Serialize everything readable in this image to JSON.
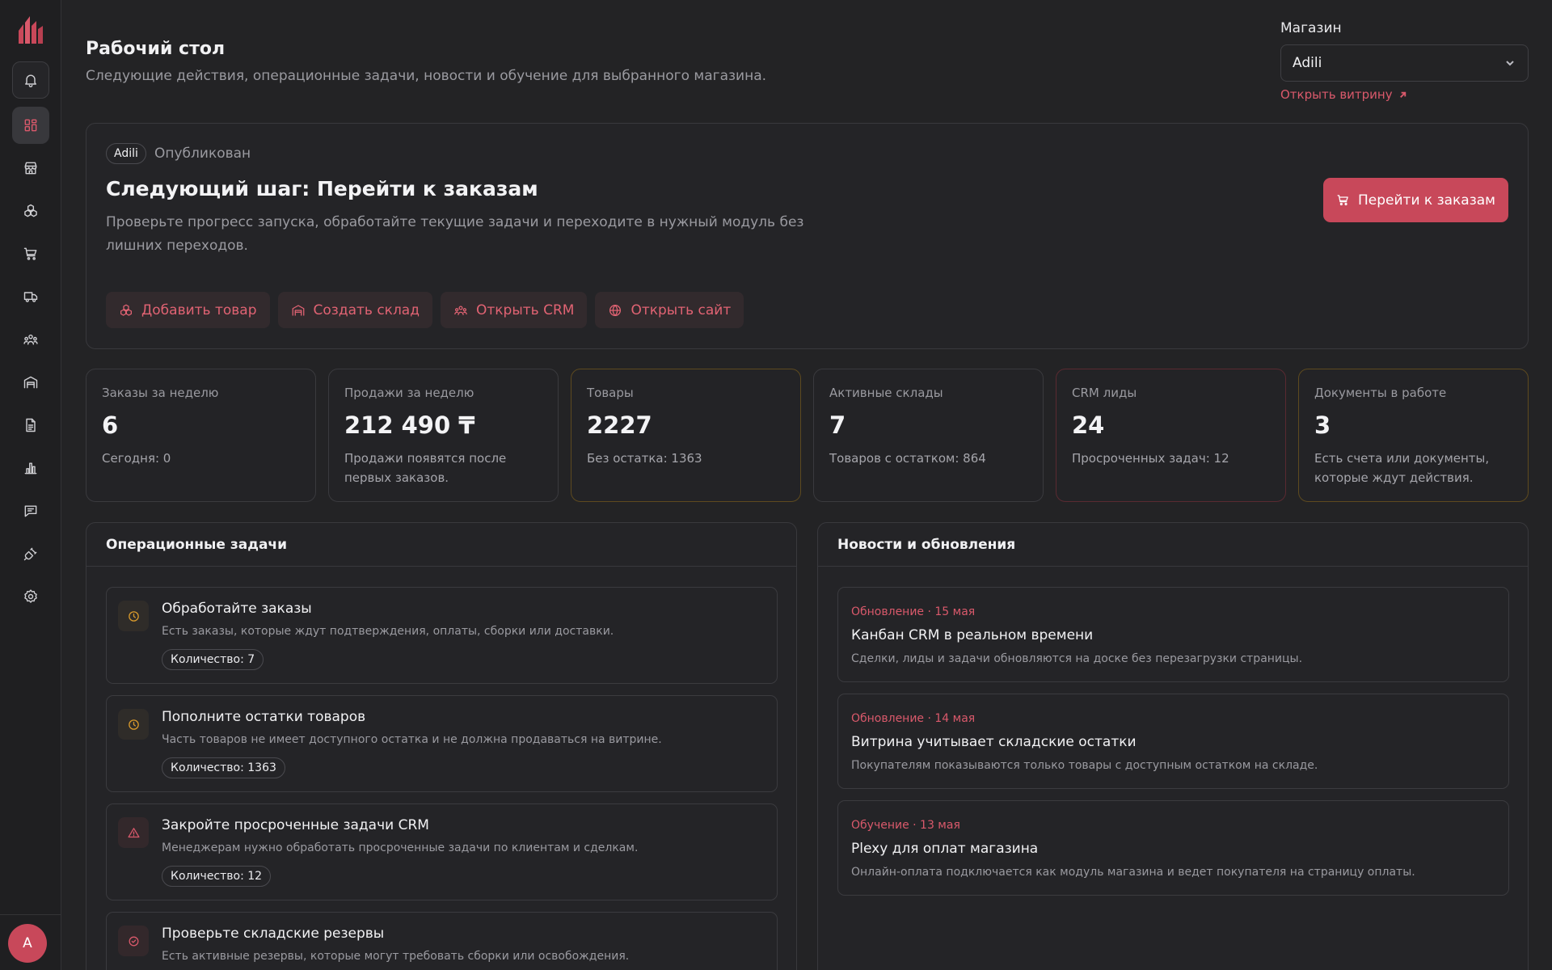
{
  "colors": {
    "accent": "#c8485a",
    "accent_text": "#d9596b",
    "warning": "#d99a2b",
    "success": "#c8485a"
  },
  "user": {
    "avatar_initial": "A"
  },
  "header": {
    "title": "Рабочий стол",
    "subtitle": "Следующие действия, операционные задачи, новости и обучение для выбранного магазина.",
    "store_label": "Магазин",
    "store_value": "Adili",
    "storefront_link": "Открыть витрину"
  },
  "sidebar": {
    "items": [
      {
        "icon": "bell-icon"
      },
      {
        "icon": "dashboard-icon",
        "active": true
      },
      {
        "icon": "store-icon"
      },
      {
        "icon": "products-icon"
      },
      {
        "icon": "cart-icon"
      },
      {
        "icon": "truck-icon"
      },
      {
        "icon": "users-icon"
      },
      {
        "icon": "warehouse-icon"
      },
      {
        "icon": "document-icon"
      },
      {
        "icon": "chart-icon"
      },
      {
        "icon": "chat-icon"
      },
      {
        "icon": "plug-icon"
      },
      {
        "icon": "settings-icon"
      }
    ]
  },
  "hero": {
    "store_badge": "Adili",
    "status": "Опубликован",
    "title": "Следующий шаг: Перейти к заказам",
    "description": "Проверьте прогресс запуска, обработайте текущие задачи и переходите в нужный модуль без лишних переходов.",
    "primary_button": "Перейти к заказам",
    "quick_actions": [
      {
        "label": "Добавить товар",
        "icon": "products-icon"
      },
      {
        "label": "Создать склад",
        "icon": "warehouse-icon"
      },
      {
        "label": "Открыть CRM",
        "icon": "users-icon"
      },
      {
        "label": "Открыть сайт",
        "icon": "globe-icon"
      }
    ]
  },
  "stats": [
    {
      "label": "Заказы за неделю",
      "value": "6",
      "note": "Сегодня: 0"
    },
    {
      "label": "Продажи за неделю",
      "value": "212 490 ₸",
      "note": "Продажи появятся после первых заказов."
    },
    {
      "label": "Товары",
      "value": "2227",
      "note": "Без остатка: 1363"
    },
    {
      "label": "Активные склады",
      "value": "7",
      "note": "Товаров с остатком: 864"
    },
    {
      "label": "CRM лиды",
      "value": "24",
      "note": "Просроченных задач: 12"
    },
    {
      "label": "Документы в работе",
      "value": "3",
      "note": "Есть счета или документы, которые ждут действия."
    }
  ],
  "tasks_panel": {
    "title": "Операционные задачи",
    "items": [
      {
        "title": "Обработайте заказы",
        "desc": "Есть заказы, которые ждут подтверждения, оплаты, сборки или доставки.",
        "count": "Количество: 7",
        "icon": "clock-icon"
      },
      {
        "title": "Пополните остатки товаров",
        "desc": "Часть товаров не имеет доступного остатка и не должна продаваться на витрине.",
        "count": "Количество: 1363",
        "icon": "clock-icon"
      },
      {
        "title": "Закройте просроченные задачи CRM",
        "desc": "Менеджерам нужно обработать просроченные задачи по клиентам и сделкам.",
        "count": "Количество: 12",
        "icon": "alert-icon"
      },
      {
        "title": "Проверьте складские резервы",
        "desc": "Есть активные резервы, которые могут требовать сборки или освобождения.",
        "count": "",
        "icon": "check-circle-icon"
      }
    ]
  },
  "news_panel": {
    "title": "Новости и обновления",
    "items": [
      {
        "meta": "Обновление · 15 мая",
        "title": "Канбан CRM в реальном времени",
        "desc": "Сделки, лиды и задачи обновляются на доске без перезагрузки страницы."
      },
      {
        "meta": "Обновление · 14 мая",
        "title": "Витрина учитывает складские остатки",
        "desc": "Покупателям показываются только товары с доступным остатком на складе."
      },
      {
        "meta": "Обучение · 13 мая",
        "title": "Plexy для оплат магазина",
        "desc": "Онлайн-оплата подключается как модуль магазина и ведет покупателя на страницу оплаты."
      }
    ]
  }
}
